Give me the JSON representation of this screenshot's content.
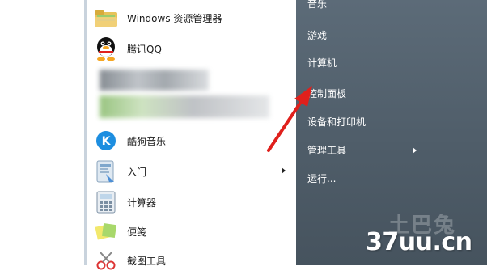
{
  "start_menu": {
    "programs": [
      {
        "label": "Windows 资源管理器",
        "icon": "explorer-folder-icon"
      },
      {
        "label": "腾讯QQ",
        "icon": "qq-penguin-icon"
      },
      {
        "label": "",
        "icon": "blurred-app-icon"
      },
      {
        "label": "",
        "icon": "blurred-app-icon"
      },
      {
        "label": "酷狗音乐",
        "icon": "kugou-icon"
      },
      {
        "label": "入门",
        "icon": "getting-started-icon",
        "has_submenu": true
      },
      {
        "label": "计算器",
        "icon": "calculator-icon"
      },
      {
        "label": "便笺",
        "icon": "sticky-notes-icon"
      },
      {
        "label": "截图工具",
        "icon": "snipping-tool-icon"
      }
    ],
    "right_items": [
      {
        "label": "音乐"
      },
      {
        "label": "游戏"
      },
      {
        "label": "计算机"
      },
      {
        "label": "控制面板"
      },
      {
        "label": "设备和打印机"
      },
      {
        "label": "管理工具",
        "has_submenu": true
      },
      {
        "label": "运行..."
      }
    ]
  },
  "watermark": {
    "text": "37uu.cn",
    "logo_text": "土巴兔"
  },
  "colors": {
    "right_panel": "#55636f",
    "annotation_arrow": "#e0201c"
  }
}
